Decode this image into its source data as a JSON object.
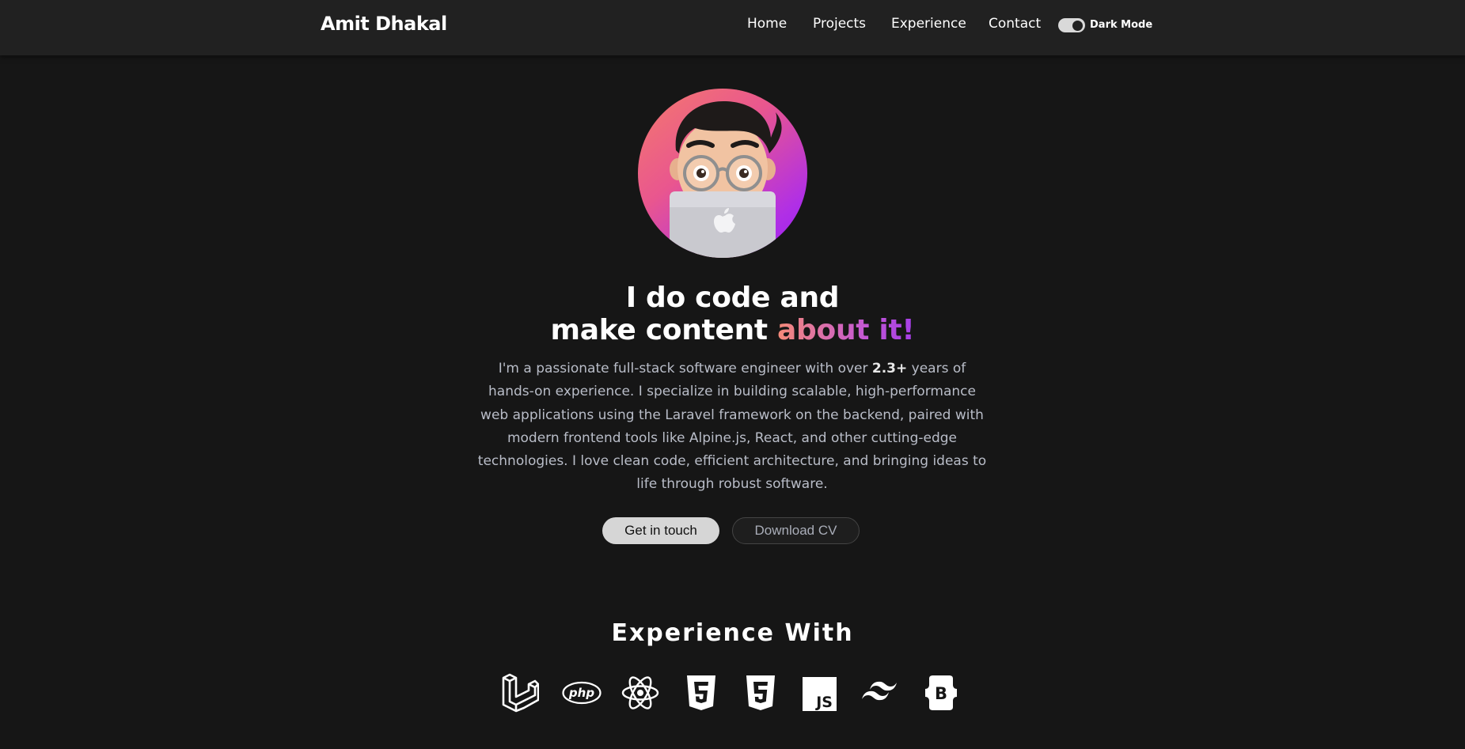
{
  "nav": {
    "brand": "Amit Dhakal",
    "links": [
      "Home",
      "Projects",
      "Experience",
      "Contact"
    ],
    "dark_mode_label": "Dark Mode",
    "dark_mode_on": true
  },
  "hero": {
    "headline_line1": "I do code and",
    "headline_line2_plain": "make content ",
    "headline_line2_accent": "about it!",
    "bio_part1": "I'm a passionate full-stack software engineer with over ",
    "bio_highlight": "2.3+",
    "bio_part2": " years of hands-on experience. I specialize in building scalable, high-performance web applications using the Laravel framework on the backend, paired with modern frontend tools like Alpine.js, React, and other cutting-edge technologies. I love clean code, efficient architecture, and bringing ideas to life through robust software.",
    "primary_button": "Get in touch",
    "secondary_button": "Download CV"
  },
  "experience": {
    "title": "Experience With",
    "icons": [
      "laravel-icon",
      "php-icon",
      "react-icon",
      "html5-icon",
      "css3-icon",
      "javascript-icon",
      "tailwind-icon",
      "bootstrap-icon"
    ],
    "php_text": "php",
    "js_text": "JS",
    "bootstrap_text": "B"
  },
  "colors": {
    "background": "#161616",
    "navbar": "#212121",
    "accent_gradient_start": "#f58a78",
    "accent_gradient_end": "#a63ee8"
  }
}
